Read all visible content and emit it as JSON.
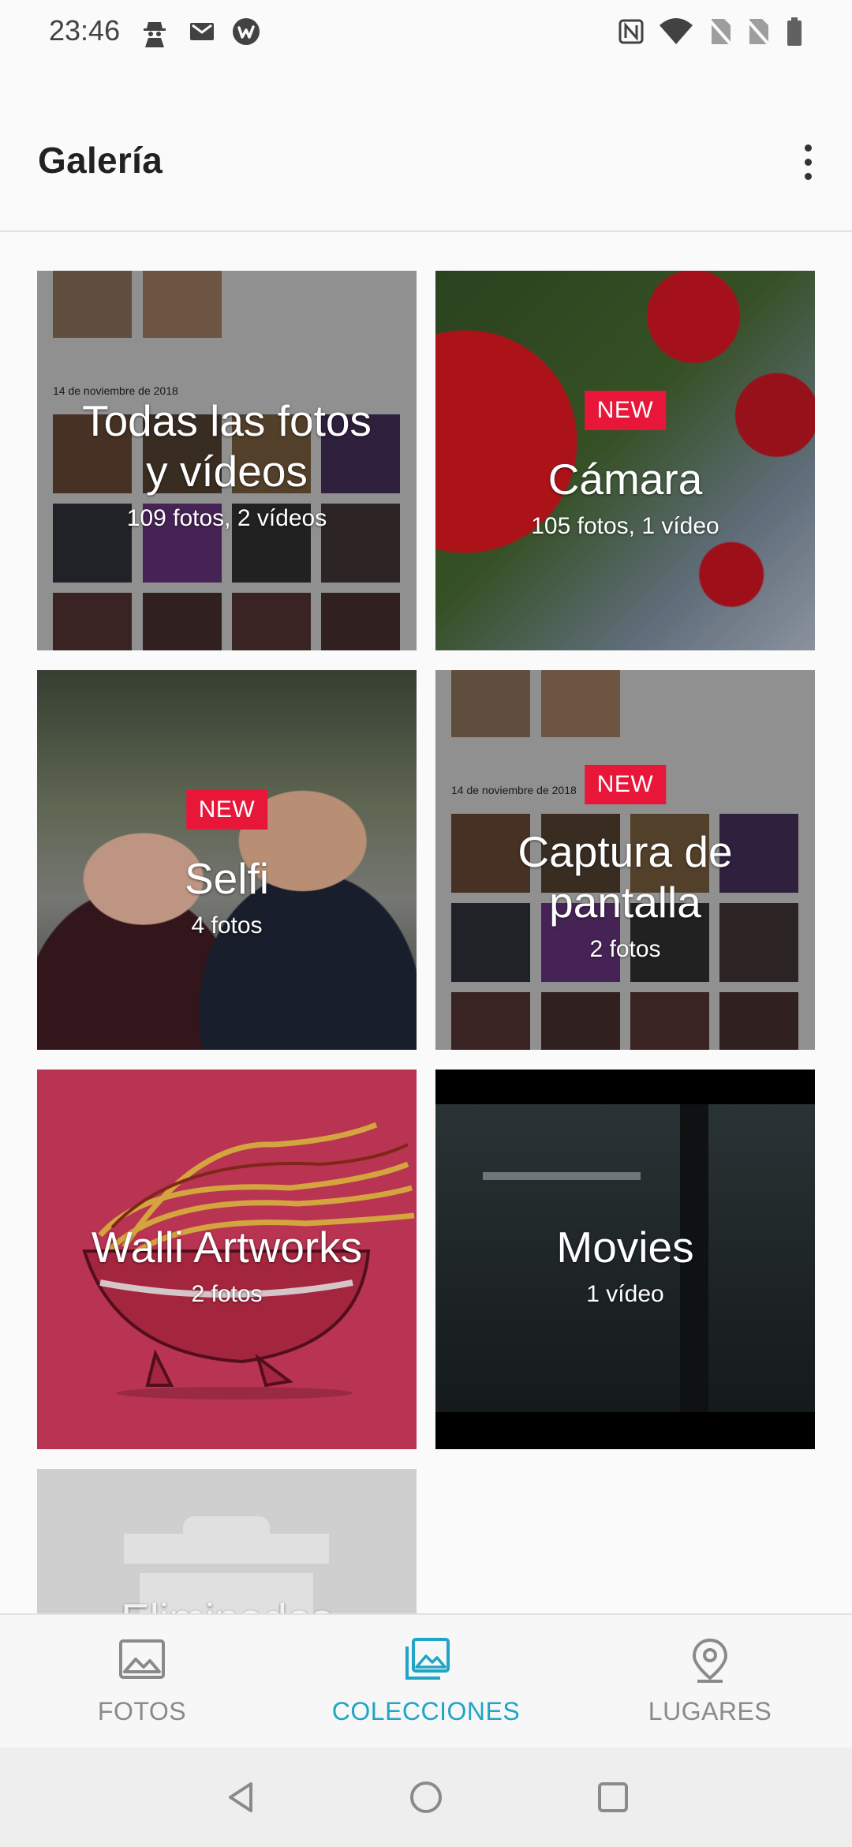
{
  "status_bar": {
    "time": "23:46",
    "left_icons": [
      "spy-icon",
      "gmail-icon",
      "wattpad-icon"
    ],
    "right_icons": [
      "nfc-icon",
      "wifi-icon",
      "no-sim-icon",
      "no-sim-icon",
      "battery-icon"
    ]
  },
  "app_bar": {
    "title": "Galería",
    "menu_icon": "more-vert-icon"
  },
  "albums": [
    {
      "id": "all",
      "title_line1": "Todas las fotos",
      "title_line2": "y vídeos",
      "count": "109 fotos, 2 vídeos",
      "badge": ""
    },
    {
      "id": "camera",
      "title_line1": "Cámara",
      "title_line2": "",
      "count": "105 fotos, 1 vídeo",
      "badge": "NEW"
    },
    {
      "id": "selfie",
      "title_line1": "Selfi",
      "title_line2": "",
      "count": "4 fotos",
      "badge": "NEW"
    },
    {
      "id": "screenshots",
      "title_line1": "Captura de",
      "title_line2": "pantalla",
      "count": "2 fotos",
      "badge": "NEW"
    },
    {
      "id": "walli",
      "title_line1": "Walli Artworks",
      "title_line2": "",
      "count": "2 fotos",
      "badge": ""
    },
    {
      "id": "movies",
      "title_line1": "Movies",
      "title_line2": "",
      "count": "1 vídeo",
      "badge": ""
    },
    {
      "id": "deleted",
      "title_line1": "Eliminados",
      "title_line2": "",
      "count": "",
      "badge": ""
    }
  ],
  "collage": {
    "date_text": "14 de noviembre de 2018"
  },
  "bottom_nav": {
    "items": [
      {
        "label": "FOTOS",
        "icon": "image-icon",
        "active": false
      },
      {
        "label": "COLECCIONES",
        "icon": "collections-icon",
        "active": true
      },
      {
        "label": "LUGARES",
        "icon": "location-pin-icon",
        "active": false
      }
    ],
    "active_color": "#1fa5c5"
  },
  "system_nav": {
    "buttons": [
      "back-icon",
      "home-icon",
      "recents-icon"
    ]
  },
  "colors": {
    "badge": "#e8173a",
    "walli_bg": "#c9385a",
    "movies_bg": "#1e2426"
  }
}
